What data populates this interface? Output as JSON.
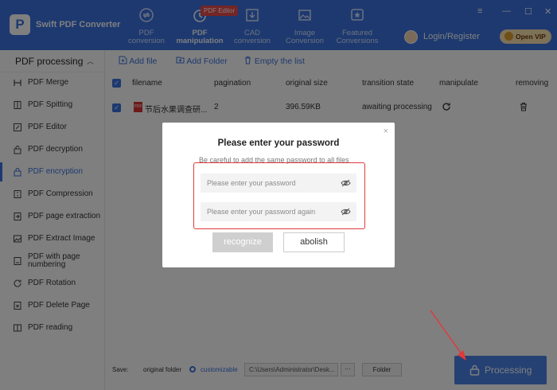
{
  "app": {
    "name": "Swift PDF Converter",
    "logo_letter": "P"
  },
  "nav": [
    {
      "label": "PDF conversion"
    },
    {
      "label": "PDF manipulation",
      "badge": "PDF Editor"
    },
    {
      "label": "CAD conversion"
    },
    {
      "label": "Image Conversion"
    },
    {
      "label": "Featured Conversions"
    }
  ],
  "header": {
    "login": "Login/Register",
    "vip": "Open VIP",
    "window_controls": [
      "≡",
      "—",
      "☐",
      "✕"
    ]
  },
  "sidebar": {
    "title": "PDF processing",
    "items": [
      {
        "label": "PDF Merge",
        "icon": "merge-icon"
      },
      {
        "label": "PDF Spitting",
        "icon": "split-icon"
      },
      {
        "label": "PDF Editor",
        "icon": "edit-icon"
      },
      {
        "label": "PDF decryption",
        "icon": "unlock-icon"
      },
      {
        "label": "PDF encryption",
        "icon": "lock-icon"
      },
      {
        "label": "PDF Compression",
        "icon": "compress-icon"
      },
      {
        "label": "PDF page extraction",
        "icon": "extract-icon"
      },
      {
        "label": "PDF Extract Image",
        "icon": "image-icon"
      },
      {
        "label": "PDF with page numbering",
        "icon": "numbering-icon"
      },
      {
        "label": "PDF Rotation",
        "icon": "rotate-icon"
      },
      {
        "label": "PDF Delete Page",
        "icon": "delete-page-icon"
      },
      {
        "label": "PDF reading",
        "icon": "read-icon"
      }
    ]
  },
  "toolbar": {
    "add_file": "Add file",
    "add_folder": "Add Folder",
    "empty": "Empty the list"
  },
  "table": {
    "columns": [
      "filename",
      "pagination",
      "original size",
      "transition state",
      "manipulate",
      "removing"
    ],
    "rows": [
      {
        "filename": "节后水果调查研...",
        "pagination": "2",
        "size": "396.59KB",
        "state": "awaiting processing"
      }
    ]
  },
  "footer": {
    "save_label": "Save:",
    "original_folder": "original folder",
    "customizable": "customizable",
    "path": "C:\\Users\\Administrator\\Desk...",
    "dots": "···",
    "folder_btn": "Folder",
    "processing": "Processing"
  },
  "dialog": {
    "title": "Please enter your password",
    "note": "Be careful to add the same password to all files",
    "pw_placeholder": "Please enter your password",
    "pw2_placeholder": "Please enter your password again",
    "confirm": "recognize",
    "cancel": "abolish",
    "close": "×"
  },
  "colors": {
    "brand": "#3a72e0",
    "highlight": "#e03a3a"
  }
}
